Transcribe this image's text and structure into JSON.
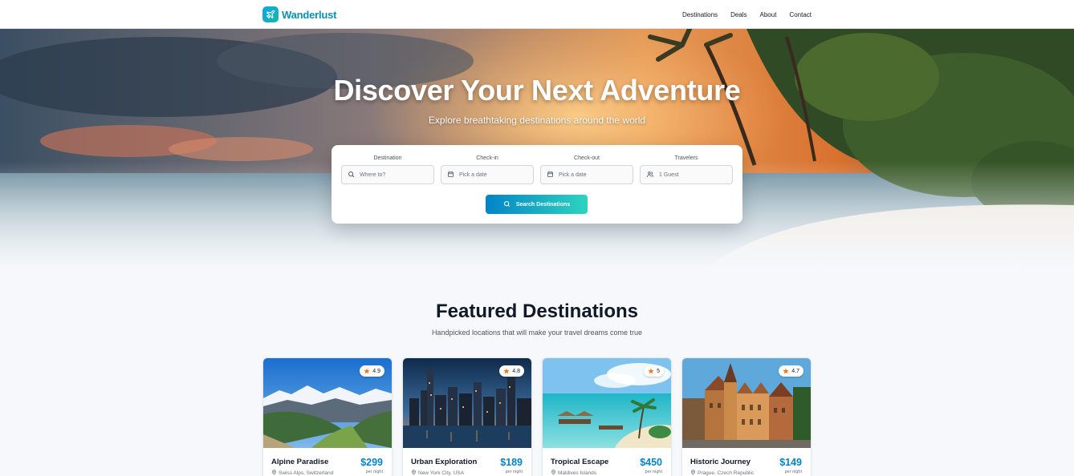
{
  "nav": {
    "brand": "Wanderlust",
    "links": [
      "Destinations",
      "Deals",
      "About",
      "Contact"
    ]
  },
  "hero": {
    "title": "Discover Your Next Adventure",
    "subtitle": "Explore breathtaking destinations around the world"
  },
  "search": {
    "destination_label": "Destination",
    "destination_placeholder": "Where to?",
    "checkin_label": "Check-in",
    "checkin_value": "Pick a date",
    "checkout_label": "Check-out",
    "checkout_value": "Pick a date",
    "travelers_label": "Travelers",
    "travelers_value": "1 Guest",
    "button_label": "Search Destinations"
  },
  "featured": {
    "title": "Featured Destinations",
    "subtitle": "Handpicked locations that will make your travel dreams come true",
    "cards": [
      {
        "name": "Alpine Paradise",
        "location": "Swiss Alps, Switzerland",
        "price": "$299",
        "per": "per night",
        "rating": "4.9"
      },
      {
        "name": "Urban Exploration",
        "location": "New York City, USA",
        "price": "$189",
        "per": "per night",
        "rating": "4.8"
      },
      {
        "name": "Tropical Escape",
        "location": "Maldives Islands",
        "price": "$450",
        "per": "per night",
        "rating": "5"
      },
      {
        "name": "Historic Journey",
        "location": "Prague, Czech Republic",
        "price": "$149",
        "per": "per night",
        "rating": "4.7"
      }
    ]
  },
  "colors": {
    "brand": "#0891b2",
    "price": "#0284c7",
    "button_start": "#0284c7",
    "button_end": "#2dd4bf",
    "star": "#f97316"
  },
  "icons": [
    "plane-icon",
    "search-icon",
    "calendar-icon",
    "users-icon",
    "star-icon",
    "map-pin-icon"
  ]
}
